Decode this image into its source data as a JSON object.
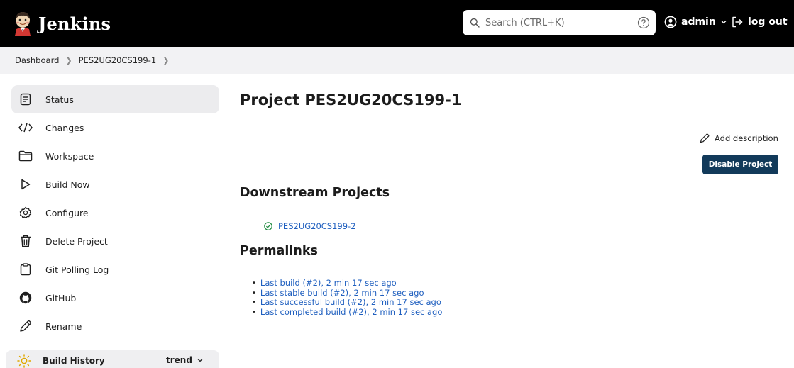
{
  "header": {
    "logo_text": "Jenkins",
    "search_placeholder": "Search (CTRL+K)",
    "user_name": "admin",
    "logout_label": "log out"
  },
  "breadcrumb": {
    "items": [
      "Dashboard",
      "PES2UG20CS199-1"
    ]
  },
  "sidebar": {
    "items": [
      {
        "label": "Status",
        "icon": "document-icon"
      },
      {
        "label": "Changes",
        "icon": "code-icon"
      },
      {
        "label": "Workspace",
        "icon": "folder-icon"
      },
      {
        "label": "Build Now",
        "icon": "play-icon"
      },
      {
        "label": "Configure",
        "icon": "gear-icon"
      },
      {
        "label": "Delete Project",
        "icon": "trash-icon"
      },
      {
        "label": "Git Polling Log",
        "icon": "clipboard-icon"
      },
      {
        "label": "GitHub",
        "icon": "github-icon"
      },
      {
        "label": "Rename",
        "icon": "pencil-icon"
      }
    ],
    "build_history_label": "Build History",
    "trend_label": "trend"
  },
  "main": {
    "title": "Project PES2UG20CS199-1",
    "add_description_label": "Add description",
    "disable_button_label": "Disable Project",
    "downstream_title": "Downstream Projects",
    "downstream_projects": [
      "PES2UG20CS199-2"
    ],
    "permalinks_title": "Permalinks",
    "permalinks": [
      "Last build (#2), 2 min 17 sec ago",
      "Last stable build (#2), 2 min 17 sec ago",
      "Last successful build (#2), 2 min 17 sec ago",
      "Last completed build (#2), 2 min 17 sec ago"
    ]
  },
  "colors": {
    "header_bg": "#000000",
    "breadcrumb_bg": "#f2f2f4",
    "link": "#1f5fbf",
    "primary_button": "#123a5a",
    "success": "#1e8a3e"
  }
}
